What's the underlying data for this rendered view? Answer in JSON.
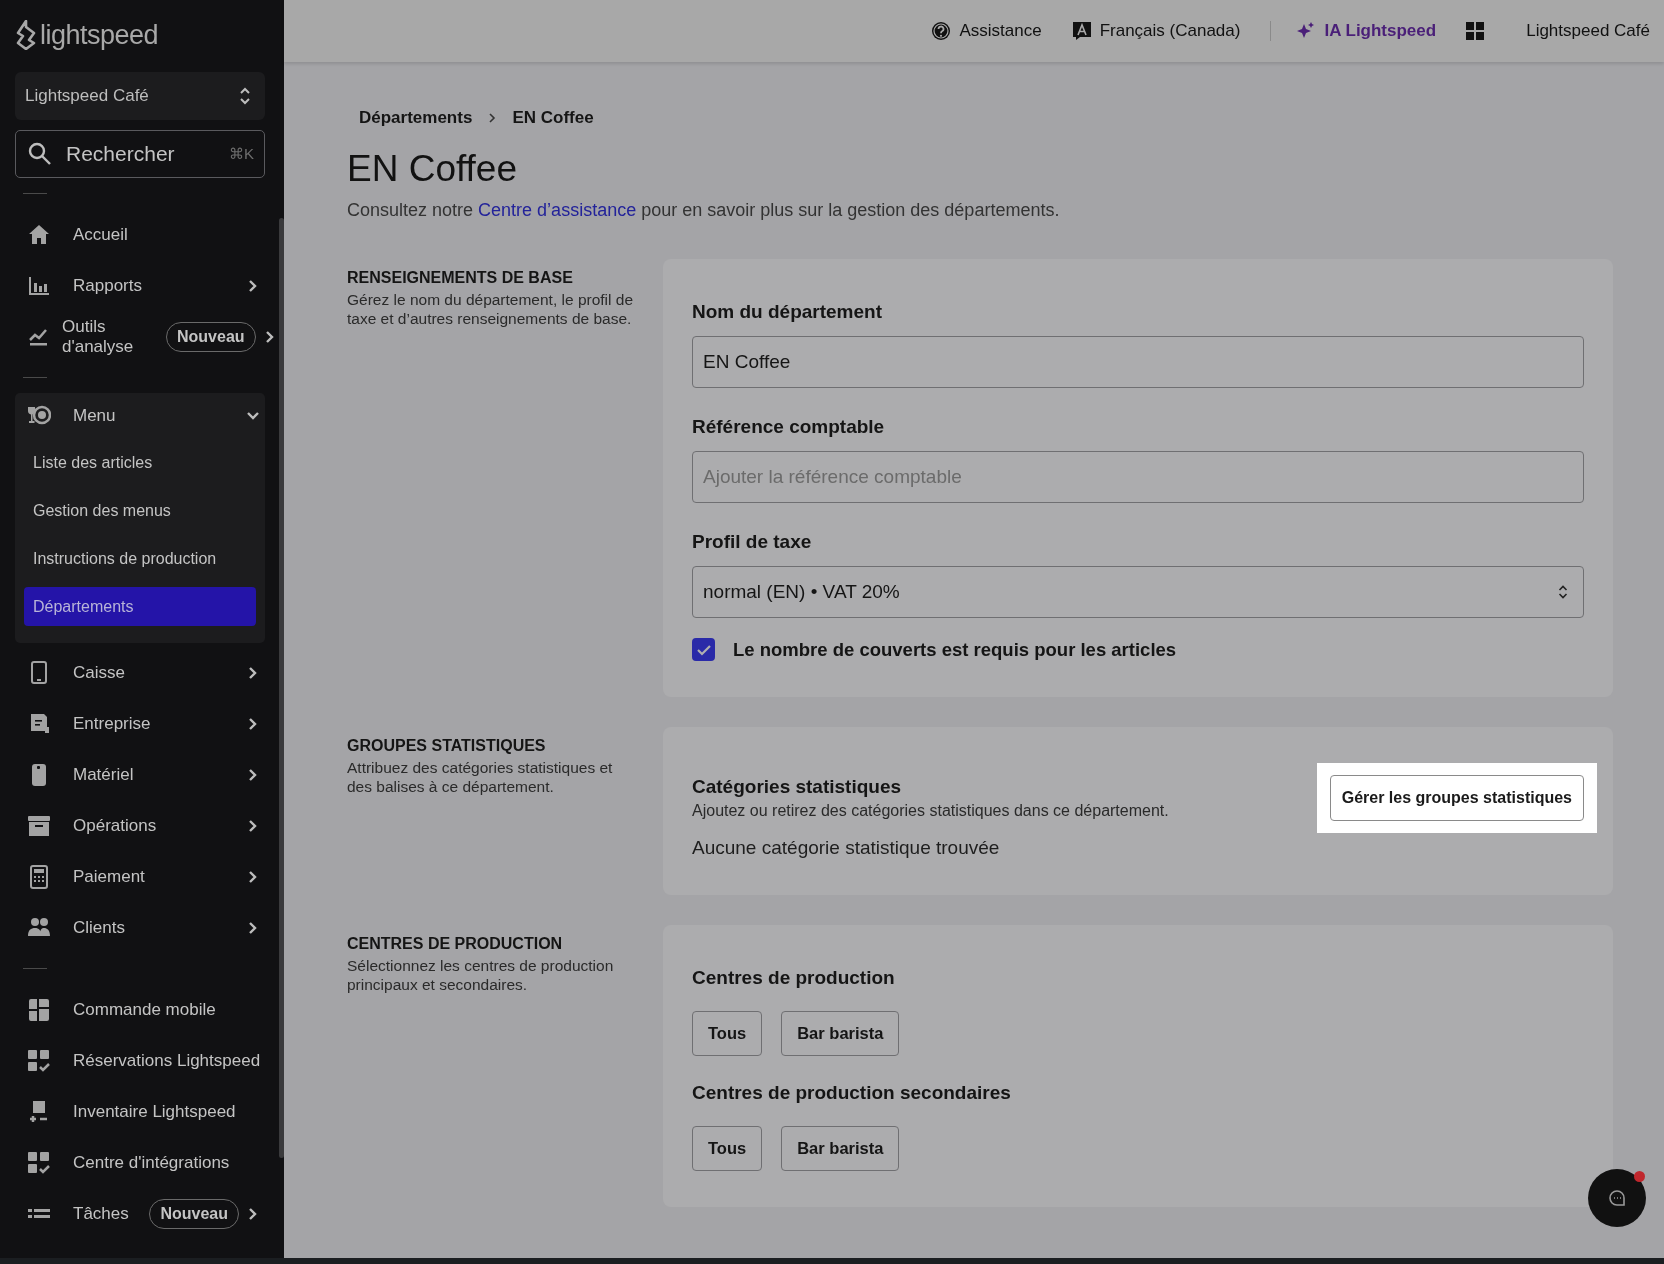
{
  "sidebar": {
    "logo": "lightspeed",
    "location": "Lightspeed Café",
    "search": {
      "placeholder": "Rechercher",
      "shortcut": "⌘K"
    },
    "sections": [
      {
        "items": [
          {
            "label": "Accueil"
          },
          {
            "label": "Rapports",
            "expanded": false
          },
          {
            "label": "Outils d'analyse",
            "badge": "Nouveau",
            "expanded": false
          }
        ]
      },
      {
        "items": [
          {
            "label": "Menu",
            "expanded": true,
            "children": [
              {
                "label": "Liste des articles",
                "selected": false
              },
              {
                "label": "Gestion des menus",
                "selected": false
              },
              {
                "label": "Instructions de production",
                "selected": false
              },
              {
                "label": "Départements",
                "selected": true
              }
            ]
          },
          {
            "label": "Caisse",
            "expanded": false
          },
          {
            "label": "Entreprise",
            "expanded": false
          },
          {
            "label": "Matériel",
            "expanded": false
          },
          {
            "label": "Opérations",
            "expanded": false
          },
          {
            "label": "Paiement",
            "expanded": false
          },
          {
            "label": "Clients",
            "expanded": false
          }
        ]
      },
      {
        "items": [
          {
            "label": "Commande mobile"
          },
          {
            "label": "Réservations Lightspeed"
          },
          {
            "label": "Inventaire Lightspeed"
          },
          {
            "label": "Centre d'intégrations"
          },
          {
            "label": "Tâches",
            "badge": "Nouveau",
            "expanded": false
          }
        ]
      }
    ]
  },
  "topbar": {
    "items": [
      {
        "kind": "help",
        "label": "Assistance"
      },
      {
        "kind": "language",
        "label": "Français (Canada)"
      },
      {
        "kind": "ai",
        "label": "IA Lightspeed"
      },
      {
        "kind": "apps"
      },
      {
        "kind": "account",
        "label": "Lightspeed Café"
      }
    ]
  },
  "breadcrumb": [
    {
      "label": "Départements"
    },
    {
      "label": "EN Coffee"
    }
  ],
  "title": "EN Coffee",
  "intro": {
    "before": "Consultez notre ",
    "link": "Centre d’assistance",
    "after": " pour en savoir plus sur la gestion des départements."
  },
  "sections": [
    {
      "kind": "form",
      "heading": "RENSEIGNEMENTS DE BASE",
      "description": "Gérez le nom du département, le profil de taxe et d’autres renseignements de base.",
      "fields": [
        {
          "kind": "text",
          "label": "Nom du département",
          "value": "EN Coffee"
        },
        {
          "kind": "text",
          "label": "Référence comptable",
          "placeholder": "Ajouter la référence comptable"
        },
        {
          "kind": "select",
          "label": "Profil de taxe",
          "value": "normal (EN) • VAT 20%"
        },
        {
          "kind": "checkbox",
          "label": "Le nombre de couverts est requis pour les articles",
          "checked": true
        }
      ]
    },
    {
      "kind": "stats",
      "heading": "GROUPES STATISTIQUES",
      "description": "Attribuez des catégories statistiques et des balises à ce département.",
      "title": "Catégories statistiques",
      "subtitle": "Ajoutez ou retirez des catégories statistiques dans ce département.",
      "button": {
        "label": "Gérer les groupes statistiques",
        "highlighted": true
      },
      "empty": "Aucune catégorie statistique trouvée"
    },
    {
      "kind": "chips",
      "heading": "CENTRES DE PRODUCTION",
      "description": "Sélectionnez les centres de production principaux et secondaires.",
      "groups": [
        {
          "title": "Centres de production",
          "chips": [
            "Tous",
            "Bar barista"
          ]
        },
        {
          "title": "Centres de production secondaires",
          "chips": [
            "Tous",
            "Bar barista"
          ]
        }
      ]
    }
  ],
  "chat": {
    "unread": true
  }
}
